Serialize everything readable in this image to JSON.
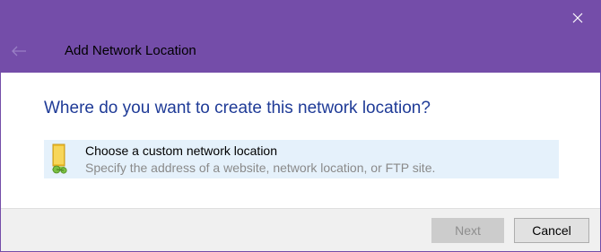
{
  "window": {
    "title": "Add Network Location",
    "accent_color": "#744da9",
    "close_icon": "close-icon",
    "back_icon": "back-arrow-icon"
  },
  "main": {
    "heading": "Where do you want to create this network location?",
    "heading_color": "#1f3b97",
    "options": [
      {
        "icon": "folder-network-icon",
        "title": "Choose a custom network location",
        "description": "Specify the address of a website, network location, or FTP site.",
        "selected": true
      }
    ]
  },
  "footer": {
    "next_label": "Next",
    "next_enabled": false,
    "cancel_label": "Cancel"
  }
}
